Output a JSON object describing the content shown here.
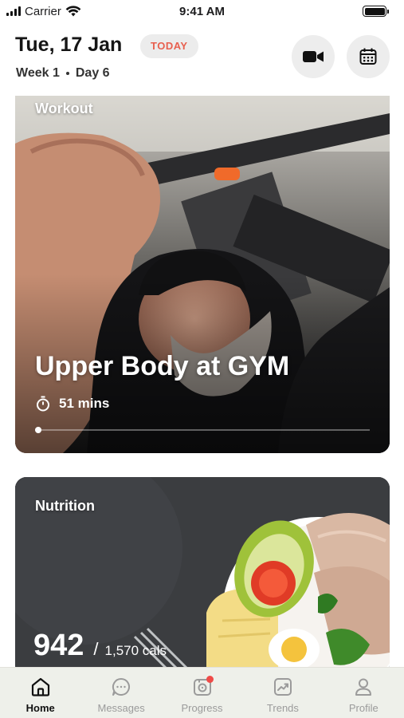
{
  "status_bar": {
    "carrier": "Carrier",
    "time": "9:41 AM",
    "battery_level": 1.0
  },
  "header": {
    "date": "Tue, 17 Jan",
    "badge": "TODAY",
    "week": "Week 1",
    "day": "Day 6",
    "video_icon": "video-camera-icon",
    "calendar_icon": "calendar-icon"
  },
  "workout": {
    "label": "Workout",
    "title": "Upper Body at GYM",
    "duration": "51 mins",
    "progress": 0.0
  },
  "nutrition": {
    "label": "Nutrition",
    "calories": "942",
    "separator": "/",
    "goal": "1,570 cals"
  },
  "tabs": [
    {
      "label": "Home",
      "icon": "home-icon",
      "active": true
    },
    {
      "label": "Messages",
      "icon": "messages-icon",
      "active": false
    },
    {
      "label": "Progress",
      "icon": "progress-icon",
      "active": false,
      "notification": true
    },
    {
      "label": "Trends",
      "icon": "trends-icon",
      "active": false
    },
    {
      "label": "Profile",
      "icon": "profile-icon",
      "active": false
    }
  ],
  "colors": {
    "accent": "#e8604f",
    "notification": "#ef4b48",
    "tab_active": "#111111",
    "tab_inactive": "#9b9b9b"
  }
}
